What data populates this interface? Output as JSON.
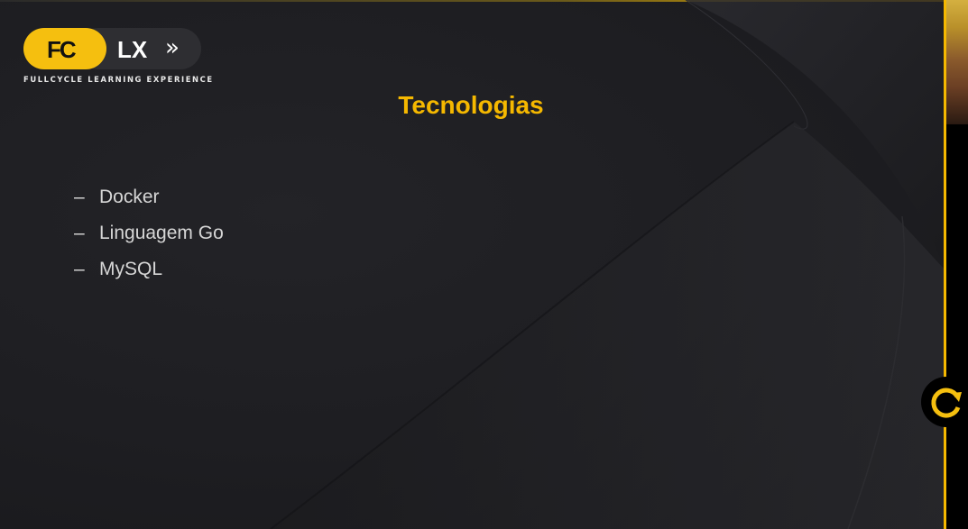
{
  "logo": {
    "fc_text": "FC",
    "lx_text": "LX",
    "chevrons_icon": "double-chevron-right-icon",
    "tagline": "FULLCYCLE LEARNING EXPERIENCE"
  },
  "slide": {
    "title": "Tecnologias",
    "items": [
      {
        "bullet": "–",
        "label": "Docker"
      },
      {
        "bullet": "–",
        "label": "Linguagem Go"
      },
      {
        "bullet": "–",
        "label": "MySQL"
      }
    ]
  },
  "controls": {
    "reload_icon": "reload-icon"
  },
  "colors": {
    "accent": "#f5b800",
    "background": "#1e1e22",
    "text": "#d6d6d6"
  }
}
